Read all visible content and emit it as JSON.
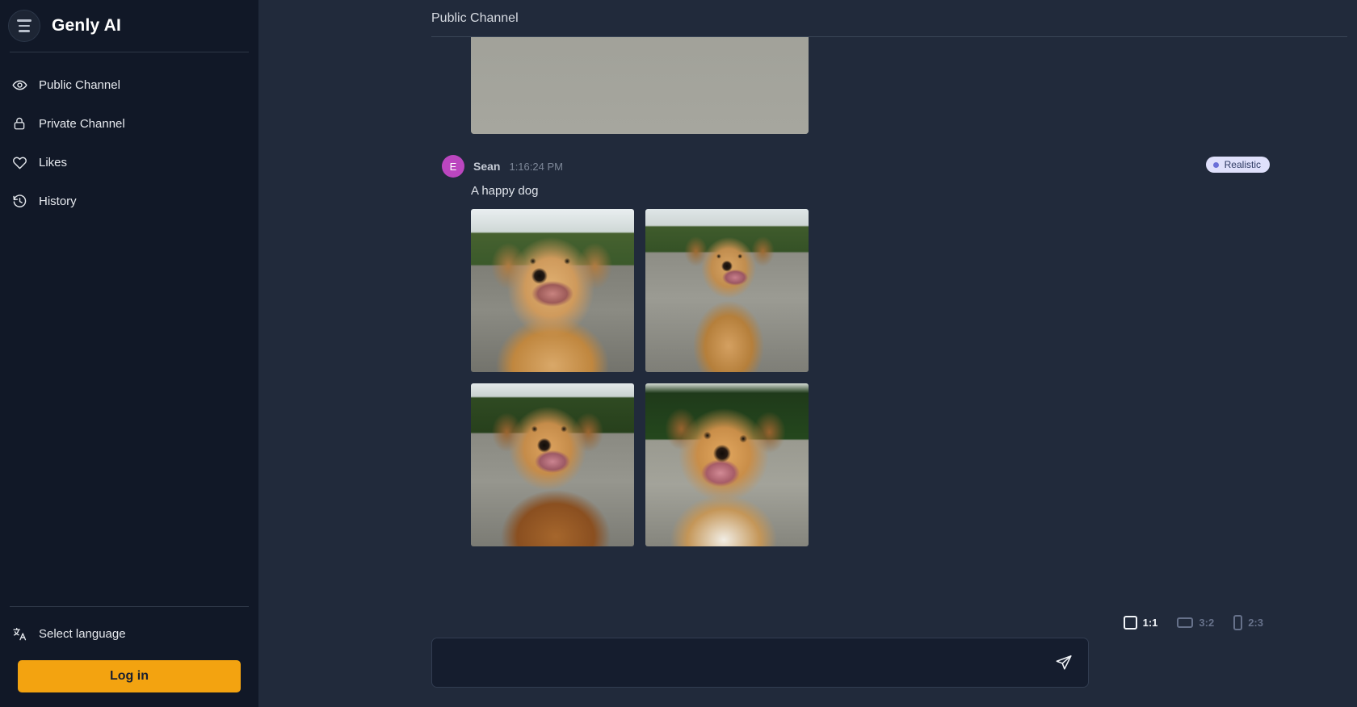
{
  "sidebar": {
    "brand": "Genly AI",
    "menu_icon": "hamburger-icon",
    "items": [
      {
        "label": "Public Channel",
        "icon": "eye-icon"
      },
      {
        "label": "Private Channel",
        "icon": "lock-icon"
      },
      {
        "label": "Likes",
        "icon": "heart-icon"
      },
      {
        "label": "History",
        "icon": "history-icon"
      }
    ],
    "language": {
      "label": "Select language",
      "icon": "translate-icon"
    },
    "login_label": "Log in",
    "login_color": "#f3a310"
  },
  "header": {
    "title": "Public Channel"
  },
  "feed": {
    "previous_image_alt": "sidewalk-and-grass-photo",
    "message": {
      "avatar_initial": "E",
      "avatar_color": "#bb46bf",
      "author": "Sean",
      "time": "1:16:24 PM",
      "badge": {
        "label": "Realistic",
        "dot_color": "#6b6fd8",
        "bg_color": "#dfe0fb"
      },
      "text": "A happy dog",
      "images": [
        {
          "alt": "golden-dog-smiling-on-street"
        },
        {
          "alt": "tan-dog-sitting-on-road"
        },
        {
          "alt": "brown-dog-smiling-closeup"
        },
        {
          "alt": "happy-dog-in-park"
        }
      ]
    }
  },
  "composer": {
    "ratios": [
      {
        "label": "1:1",
        "selected": true
      },
      {
        "label": "3:2",
        "selected": false
      },
      {
        "label": "2:3",
        "selected": false
      }
    ],
    "input_value": "",
    "input_placeholder": "",
    "send_icon": "send-icon"
  }
}
